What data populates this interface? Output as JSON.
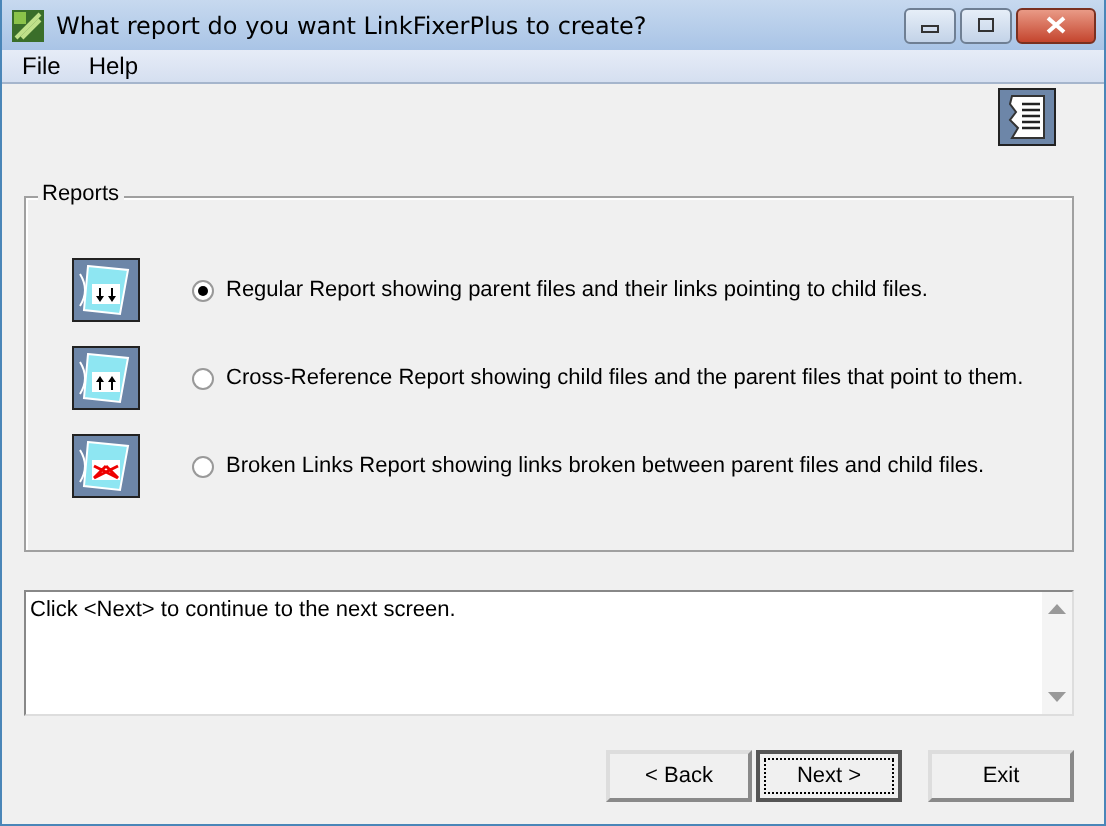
{
  "window": {
    "title": "What report do you want LinkFixerPlus to create?"
  },
  "menu": [
    "File",
    "Help"
  ],
  "reports": {
    "title": "Reports",
    "options": [
      {
        "label": "Regular Report showing parent files and their links pointing to child files.",
        "selected": true,
        "kind": "regular"
      },
      {
        "label": "Cross-Reference Report showing child files and the parent files that point to them.",
        "selected": false,
        "kind": "cross"
      },
      {
        "label": "Broken Links Report showing links broken between parent files and child files.",
        "selected": false,
        "kind": "broken"
      }
    ]
  },
  "message": "Click <Next> to continue to the next screen.",
  "buttons": [
    {
      "label": "< Back",
      "default": false
    },
    {
      "label": "Next >",
      "default": true
    },
    {
      "label": "Exit",
      "default": false
    }
  ]
}
